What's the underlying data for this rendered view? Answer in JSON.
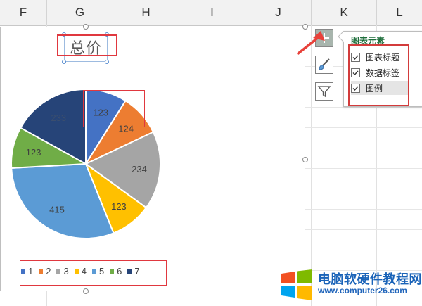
{
  "columns": [
    "F",
    "G",
    "H",
    "I",
    "J",
    "K",
    "L"
  ],
  "chart": {
    "title": "总价",
    "slice_labels": [
      "123",
      "124",
      "234",
      "123",
      "415",
      "123",
      "233"
    ]
  },
  "chart_data": {
    "type": "pie",
    "title": "总价",
    "categories": [
      "1",
      "2",
      "3",
      "4",
      "5",
      "6",
      "7"
    ],
    "values": [
      123,
      124,
      234,
      123,
      415,
      123,
      233
    ],
    "colors": [
      "#4472c4",
      "#ed7d31",
      "#a5a5a5",
      "#ffc000",
      "#5b9bd5",
      "#70ad47",
      "#264478"
    ],
    "legend_position": "bottom",
    "data_labels": true
  },
  "legend": [
    {
      "label": "1",
      "color": "#4472c4"
    },
    {
      "label": "2",
      "color": "#ed7d31"
    },
    {
      "label": "3",
      "color": "#a5a5a5"
    },
    {
      "label": "4",
      "color": "#ffc000"
    },
    {
      "label": "5",
      "color": "#5b9bd5"
    },
    {
      "label": "6",
      "color": "#70ad47"
    },
    {
      "label": "7",
      "color": "#264478"
    }
  ],
  "side_buttons": [
    {
      "name": "chart-elements-button",
      "icon": "plus-icon"
    },
    {
      "name": "chart-styles-button",
      "icon": "paintbrush-icon"
    },
    {
      "name": "chart-filters-button",
      "icon": "filter-icon"
    }
  ],
  "panel": {
    "title": "图表元素",
    "options": [
      {
        "label": "图表标题",
        "checked": true
      },
      {
        "label": "数据标签",
        "checked": true
      },
      {
        "label": "图例",
        "checked": true
      }
    ]
  },
  "watermark": {
    "text": "电脑软硬件教程网",
    "url": "www.computer26.com"
  },
  "colors": {
    "highlight_red": "#e0383f",
    "panel_title_green": "#1e6e3b",
    "accent_arrow": "#e8413a"
  }
}
